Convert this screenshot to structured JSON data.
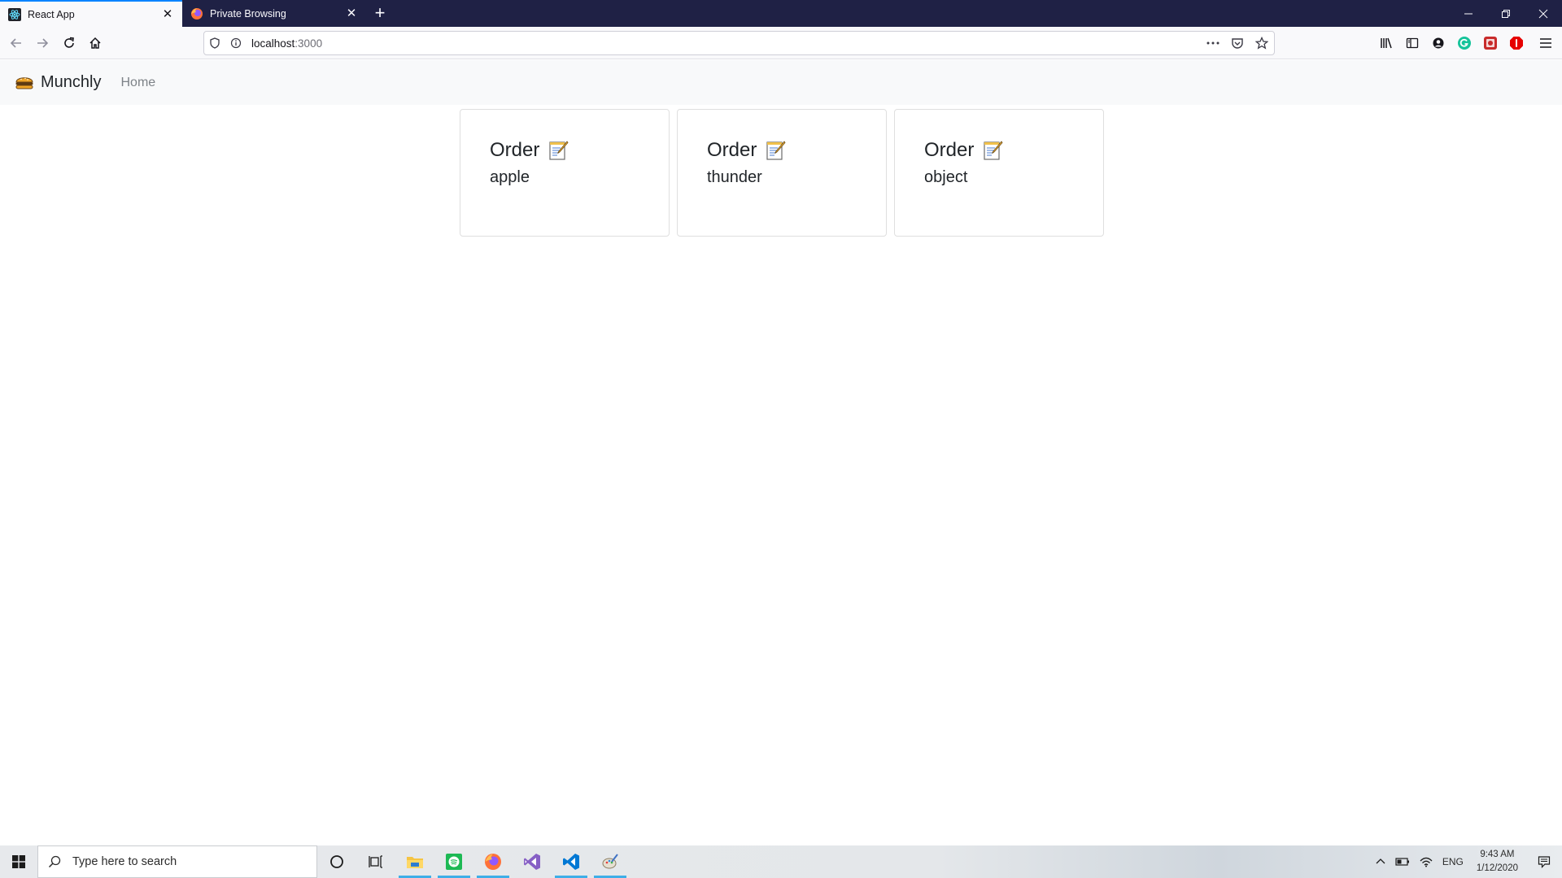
{
  "browser": {
    "tabs": [
      {
        "title": "React App",
        "favicon": "react-icon",
        "active": true
      },
      {
        "title": "Private Browsing",
        "favicon": "firefox-icon",
        "active": false
      }
    ],
    "url": {
      "host": "localhost",
      "port": ":3000"
    }
  },
  "app": {
    "brand": "Munchly",
    "brand_icon": "burger-icon",
    "nav_links": [
      "Home"
    ]
  },
  "cards": [
    {
      "title": "Order",
      "icon": "memo-icon",
      "text": "apple"
    },
    {
      "title": "Order",
      "icon": "memo-icon",
      "text": "thunder"
    },
    {
      "title": "Order",
      "icon": "memo-icon",
      "text": "object"
    }
  ],
  "taskbar": {
    "search_placeholder": "Type here to search",
    "language": "ENG",
    "time": "9:43 AM",
    "date": "1/12/2020"
  },
  "colors": {
    "tab_bar": "#1f2145",
    "active_tab_accent": "#0a84ff",
    "page_nav_bg": "#f8f9fa",
    "card_border": "#dfdfdf"
  }
}
